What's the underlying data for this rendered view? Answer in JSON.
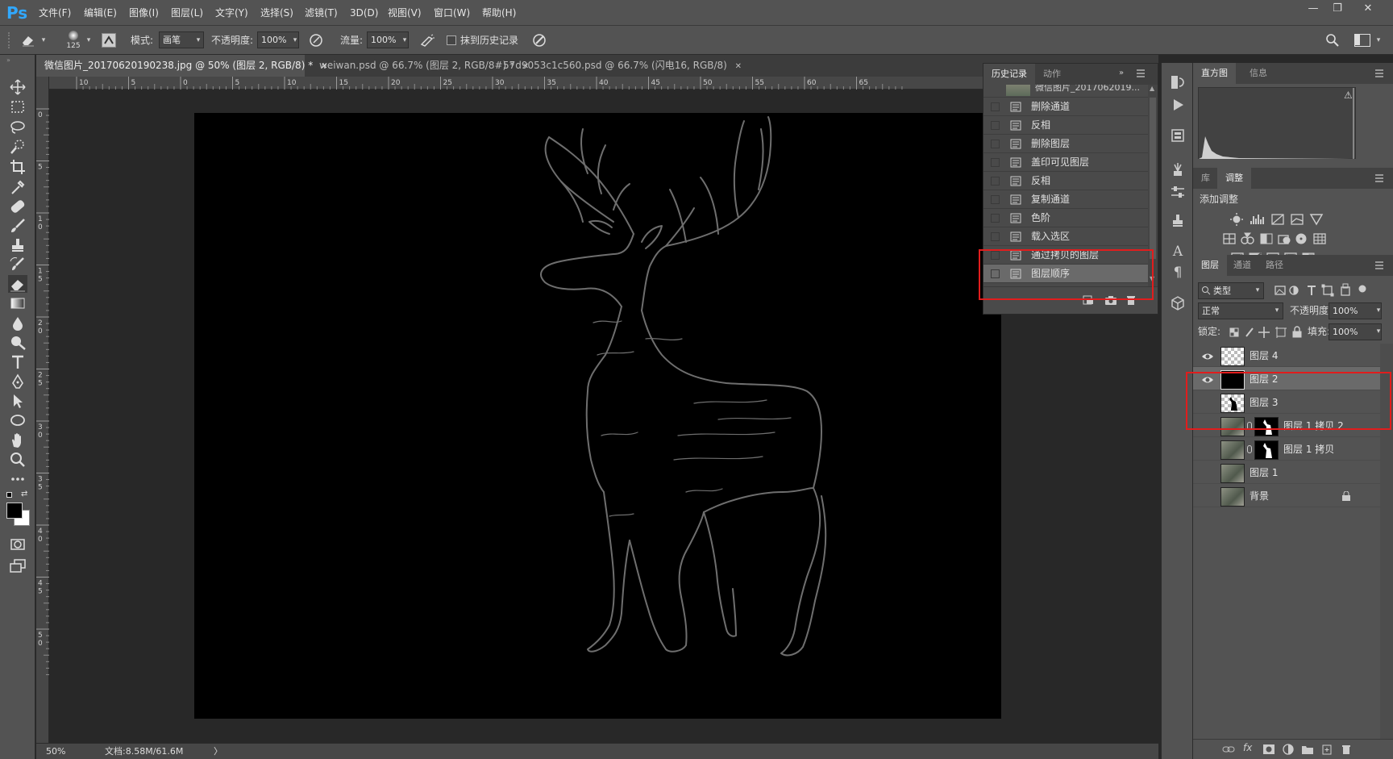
{
  "app": {
    "logo": "Ps"
  },
  "menu": [
    "文件(F)",
    "编辑(E)",
    "图像(I)",
    "图层(L)",
    "文字(Y)",
    "选择(S)",
    "滤镜(T)",
    "3D(D)",
    "视图(V)",
    "窗口(W)",
    "帮助(H)"
  ],
  "window_controls": {
    "minimize": "—",
    "restore": "❐",
    "close": "✕"
  },
  "options": {
    "brush_size": "125",
    "mode_label": "模式:",
    "mode_value": "画笔",
    "opacity_label": "不透明度:",
    "opacity_value": "100%",
    "flow_label": "流量:",
    "flow_value": "100%",
    "erase_history_label": "抹到历史记录",
    "erase_history_checked": false
  },
  "doc_tabs": [
    {
      "label": "微信图片_20170620190238.jpg @ 50% (图层 2, RGB/8) *",
      "close": "✕",
      "active": true
    },
    {
      "label": "weiwan.psd @ 66.7% (图层 2, RGB/8#) *",
      "close": "✕",
      "active": false
    },
    {
      "label": "57d9053c1c560.psd @ 66.7% (闪电16, RGB/8)",
      "close": "✕",
      "active": false
    }
  ],
  "ruler_h": [
    "10",
    "5",
    "0",
    "5",
    "10",
    "15",
    "20",
    "25",
    "30",
    "35",
    "40",
    "45",
    "50",
    "55",
    "60",
    "65"
  ],
  "ruler_v": [
    "0",
    "5",
    "1 0",
    "1 5",
    "2 0",
    "2 5",
    "3 0",
    "3 5",
    "4 0",
    "4 5",
    "5 0"
  ],
  "status": {
    "zoom": "50%",
    "doc": "文档:8.58M/61.6M",
    "arrow": "〉"
  },
  "history": {
    "tabs": [
      "历史记录",
      "动作"
    ],
    "snapshot_label": "微信图片_2017062019...",
    "items": [
      "删除通道",
      "反相",
      "删除图层",
      "盖印可见图层",
      "反相",
      "复制通道",
      "色阶",
      "载入选区",
      "通过拷贝的图层",
      "图层顺序"
    ],
    "selected_index": 9,
    "highlighted_items": [
      "通过拷贝的图层",
      "图层顺序"
    ]
  },
  "histogram": {
    "tabs": [
      "直方图",
      "信息"
    ],
    "warning": "⚠"
  },
  "adjustments": {
    "tabs": [
      "库",
      "调整"
    ],
    "title": "添加调整"
  },
  "layers": {
    "tabs": [
      "图层",
      "通道",
      "路径"
    ],
    "filter_label": "类型",
    "blend_mode": "正常",
    "opacity_label": "不透明度:",
    "opacity_value": "100%",
    "lock_label": "锁定:",
    "fill_label": "填充:",
    "fill_value": "100%",
    "items": [
      {
        "name": "图层 4",
        "visible": true,
        "thumb": "transparent"
      },
      {
        "name": "图层 2",
        "visible": true,
        "thumb": "black",
        "selected": true
      },
      {
        "name": "图层 3",
        "visible": false,
        "thumb": "deer-silhouette"
      },
      {
        "name": "图层 1 拷贝 2",
        "visible": false,
        "thumb": "photo-with-mask"
      },
      {
        "name": "图层 1 拷贝",
        "visible": false,
        "thumb": "photo-with-mask"
      },
      {
        "name": "图层 1",
        "visible": false,
        "thumb": "photo"
      },
      {
        "name": "背景",
        "visible": false,
        "thumb": "photo",
        "locked": true
      }
    ],
    "highlighted_layers": [
      "图层 4",
      "图层 2"
    ],
    "footer_fx": "fx"
  },
  "colors": {
    "accent": "#31a8ff",
    "highlight_red": "#e11d1d",
    "panel": "#535353",
    "canvas": "#000000",
    "outline": "#6e6e6e"
  }
}
